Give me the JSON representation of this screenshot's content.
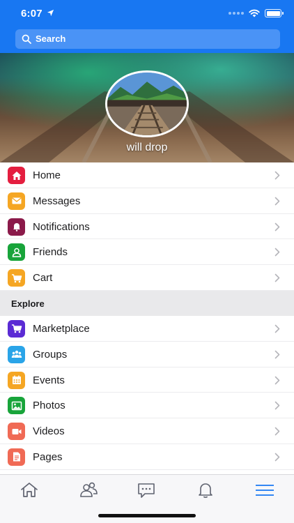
{
  "status_bar": {
    "time": "6:07"
  },
  "search": {
    "label": "Search"
  },
  "profile": {
    "name": "will drop"
  },
  "menu": {
    "main_items": [
      {
        "label": "Home",
        "icon": "home-icon",
        "color": "#e41e3f"
      },
      {
        "label": "Messages",
        "icon": "envelope-icon",
        "color": "#f5a623"
      },
      {
        "label": "Notifications",
        "icon": "bell-icon",
        "color": "#8b1a4a"
      },
      {
        "label": "Friends",
        "icon": "person-icon",
        "color": "#18a43a"
      },
      {
        "label": "Cart",
        "icon": "cart-icon",
        "color": "#f5a623"
      }
    ],
    "section_title": "Explore",
    "explore_items": [
      {
        "label": "Marketplace",
        "icon": "cart-icon",
        "color": "#5b2bd4"
      },
      {
        "label": "Groups",
        "icon": "group-icon",
        "color": "#2aa4e8"
      },
      {
        "label": "Events",
        "icon": "calendar-icon",
        "color": "#f5a623"
      },
      {
        "label": "Photos",
        "icon": "image-icon",
        "color": "#18a43a"
      },
      {
        "label": "Videos",
        "icon": "video-camera-icon",
        "color": "#f06a55"
      },
      {
        "label": "Pages",
        "icon": "document-icon",
        "color": "#f06a55"
      }
    ]
  },
  "tab_bar": {
    "tabs": [
      {
        "icon": "home-icon",
        "active": false
      },
      {
        "icon": "friends-icon",
        "active": false
      },
      {
        "icon": "chat-icon",
        "active": false
      },
      {
        "icon": "bell-icon",
        "active": false
      },
      {
        "icon": "menu-icon",
        "active": true
      }
    ],
    "active_color": "#1877f2",
    "inactive_color": "#5f6370"
  },
  "colors": {
    "header": "#1877f2",
    "search_field": "#4a93f6"
  }
}
